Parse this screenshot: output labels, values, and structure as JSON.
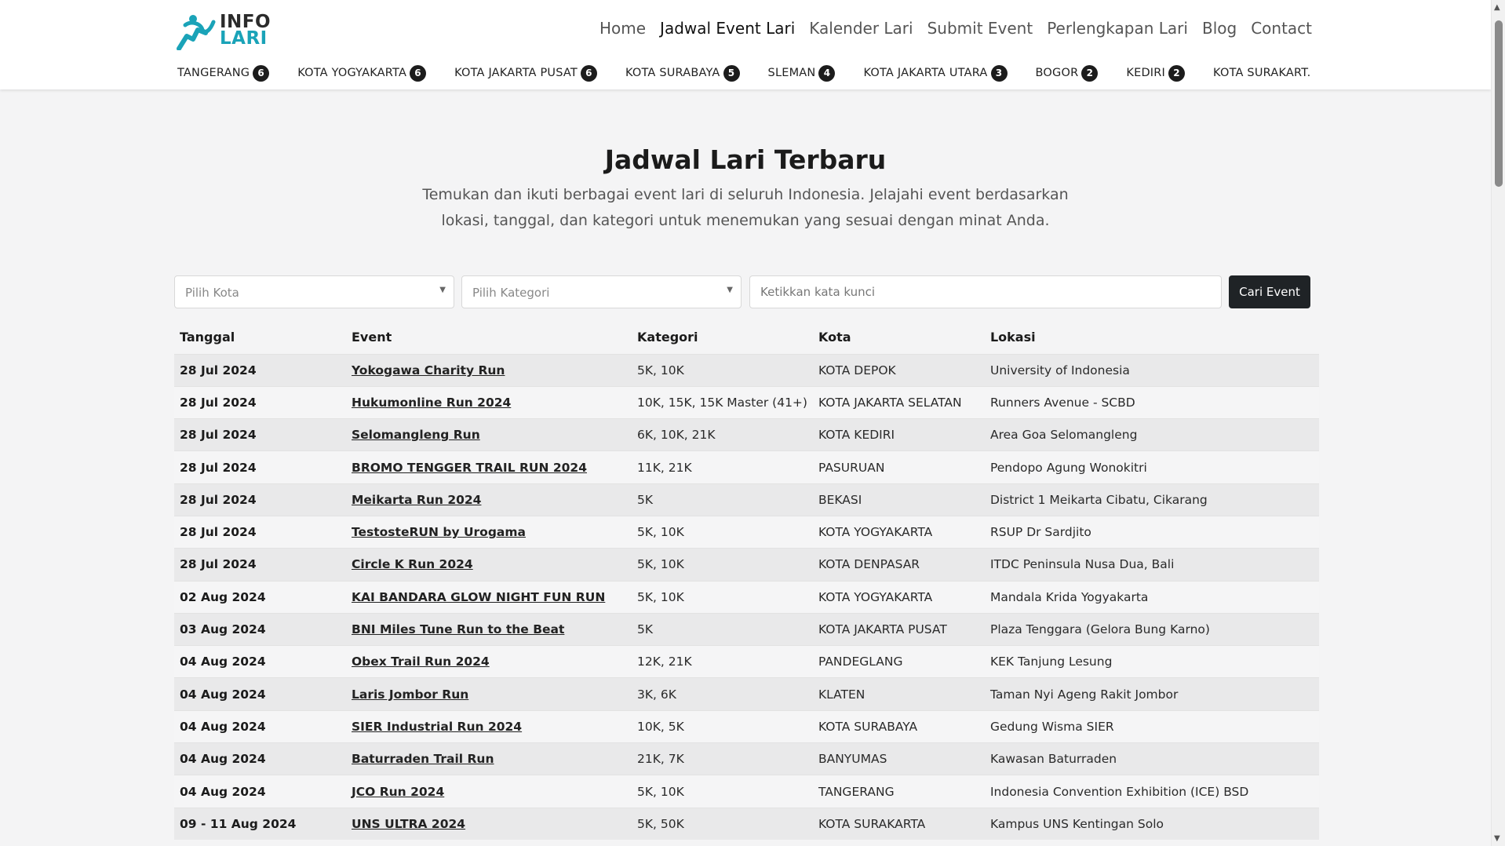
{
  "header": {
    "logo": {
      "line1": "INFO",
      "line2": "LARI"
    },
    "nav": [
      {
        "label": "Home"
      },
      {
        "label": "Jadwal Event Lari",
        "active": true
      },
      {
        "label": "Kalender Lari"
      },
      {
        "label": "Submit Event"
      },
      {
        "label": "Perlengkapan Lari"
      },
      {
        "label": "Blog"
      },
      {
        "label": "Contact"
      }
    ],
    "cities": [
      {
        "name": "TANGERANG",
        "count": "6"
      },
      {
        "name": "KOTA YOGYAKARTA",
        "count": "6"
      },
      {
        "name": "KOTA JAKARTA PUSAT",
        "count": "6"
      },
      {
        "name": "KOTA SURABAYA",
        "count": "5"
      },
      {
        "name": "SLEMAN",
        "count": "4"
      },
      {
        "name": "KOTA JAKARTA UTARA",
        "count": "3"
      },
      {
        "name": "BOGOR",
        "count": "2"
      },
      {
        "name": "KEDIRI",
        "count": "2"
      },
      {
        "name": "KOTA SURAKART.",
        "count": ""
      }
    ]
  },
  "hero": {
    "title": "Jadwal Lari Terbaru",
    "subtitle": "Temukan dan ikuti berbagai event lari di seluruh Indonesia. Jelajahi event berdasarkan lokasi, tanggal, dan kategori untuk menemukan yang sesuai dengan minat Anda."
  },
  "filters": {
    "city_placeholder": "Pilih Kota",
    "category_placeholder": "Pilih Kategori",
    "keyword_placeholder": "Ketikkan kata kunci",
    "search_button": "Cari Event"
  },
  "table": {
    "headers": [
      "Tanggal",
      "Event",
      "Kategori",
      "Kota",
      "Lokasi"
    ],
    "rows": [
      [
        "28 Jul 2024",
        "Yokogawa Charity Run",
        "5K, 10K",
        "KOTA DEPOK",
        "University of Indonesia"
      ],
      [
        "28 Jul 2024",
        "Hukumonline Run 2024",
        "10K, 15K, 15K Master (41+)",
        "KOTA JAKARTA SELATAN",
        "Runners Avenue - SCBD"
      ],
      [
        "28 Jul 2024",
        "Selomangleng Run",
        "6K, 10K, 21K",
        "KOTA KEDIRI",
        "Area Goa Selomangleng"
      ],
      [
        "28 Jul 2024",
        "BROMO TENGGER TRAIL RUN 2024",
        "11K, 21K",
        "PASURUAN",
        "Pendopo Agung Wonokitri"
      ],
      [
        "28 Jul 2024",
        "Meikarta Run 2024",
        "5K",
        "BEKASI",
        "District 1 Meikarta Cibatu, Cikarang"
      ],
      [
        "28 Jul 2024",
        "TestosteRUN by Urogama",
        "5K, 10K",
        "KOTA YOGYAKARTA",
        "RSUP Dr Sardjito"
      ],
      [
        "28 Jul 2024",
        "Circle K Run 2024",
        "5K, 10K",
        "KOTA DENPASAR",
        "ITDC Peninsula Nusa Dua, Bali"
      ],
      [
        "02 Aug 2024",
        "KAI BANDARA GLOW NIGHT FUN RUN",
        "5K, 10K",
        "KOTA YOGYAKARTA",
        "Mandala Krida Yogyakarta"
      ],
      [
        "03 Aug 2024",
        "BNI Miles Tune Run to the Beat",
        "5K",
        "KOTA JAKARTA PUSAT",
        "Plaza Tenggara (Gelora Bung Karno)"
      ],
      [
        "04 Aug 2024",
        "Obex Trail Run 2024",
        "12K, 21K",
        "PANDEGLANG",
        "KEK Tanjung Lesung"
      ],
      [
        "04 Aug 2024",
        "Laris Jombor Run",
        "3K, 6K",
        "KLATEN",
        "Taman Nyi Ageng Rakit Jombor"
      ],
      [
        "04 Aug 2024",
        "SIER Industrial Run 2024",
        "10K, 5K",
        "KOTA SURABAYA",
        "Gedung Wisma SIER"
      ],
      [
        "04 Aug 2024",
        "Baturraden Trail Run",
        "21K, 7K",
        "BANYUMAS",
        "Kawasan Baturraden"
      ],
      [
        "04 Aug 2024",
        "JCO Run 2024",
        "5K, 10K",
        "TANGERANG",
        "Indonesia Convention Exhibition (ICE) BSD"
      ],
      [
        "09 - 11 Aug 2024",
        "UNS ULTRA 2024",
        "5K, 50K",
        "KOTA SURAKARTA",
        "Kampus UNS Kentingan Solo"
      ]
    ]
  },
  "colors": {
    "accent": "#1aa3b8",
    "dark_button": "#1f2326",
    "row_stripe": "#e9e9ea"
  }
}
